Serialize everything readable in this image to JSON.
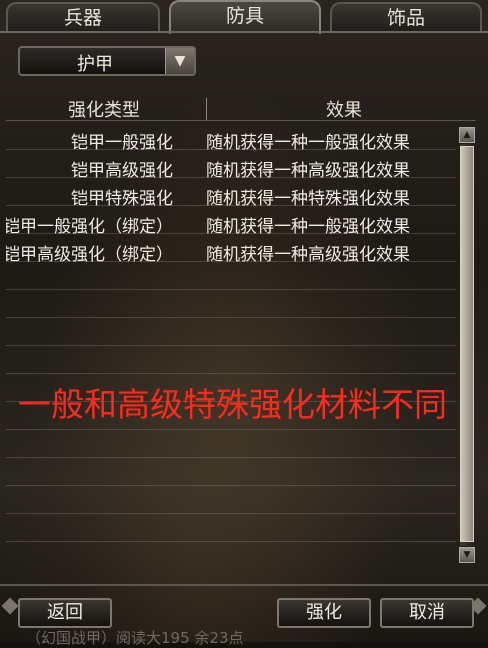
{
  "tabs": [
    {
      "label": "兵器",
      "active": false
    },
    {
      "label": "防具",
      "active": true
    },
    {
      "label": "饰品",
      "active": false
    }
  ],
  "dropdown": {
    "value": "护甲",
    "icon": "chevron-down-icon"
  },
  "table": {
    "columns": [
      "强化类型",
      "效果"
    ],
    "rows": [
      {
        "type": "铠甲一般强化",
        "effect": "随机获得一种一般强化效果"
      },
      {
        "type": "铠甲高级强化",
        "effect": "随机获得一种高级强化效果"
      },
      {
        "type": "铠甲特殊强化",
        "effect": "随机获得一种特殊强化效果"
      },
      {
        "type": "铠甲一般强化（绑定）",
        "effect": "随机获得一种一般强化效果"
      },
      {
        "type": "铠甲高级强化（绑定）",
        "effect": "随机获得一种高级强化效果"
      }
    ]
  },
  "annotation": "一般和高级特殊强化材料不同",
  "buttons": {
    "back": "返回",
    "enhance": "强化",
    "cancel": "取消"
  },
  "footer": "（幻国战甲）阅读大195 余23点",
  "colors": {
    "annotation": "#ff2a1a",
    "text": "#f1ece1"
  }
}
